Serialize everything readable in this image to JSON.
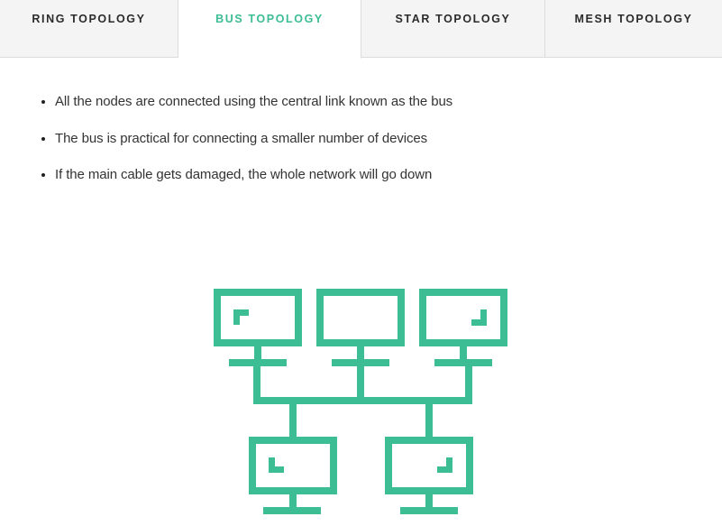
{
  "tabs": [
    {
      "label": "RING TOPOLOGY",
      "active": false
    },
    {
      "label": "BUS TOPOLOGY",
      "active": true
    },
    {
      "label": "STAR TOPOLOGY",
      "active": false
    },
    {
      "label": "MESH TOPOLOGY",
      "active": false
    }
  ],
  "content": {
    "bullets": [
      "All the nodes are connected using the central link known as the bus",
      "The bus is practical for connecting a smaller number of devices",
      "If the main cable gets damaged, the whole network will go down"
    ]
  },
  "colors": {
    "accent": "#3dbd94",
    "tab_bg": "#f4f4f4",
    "text": "#333333"
  },
  "diagram": {
    "icon": "bus-topology-network-icon",
    "nodes": 5
  }
}
